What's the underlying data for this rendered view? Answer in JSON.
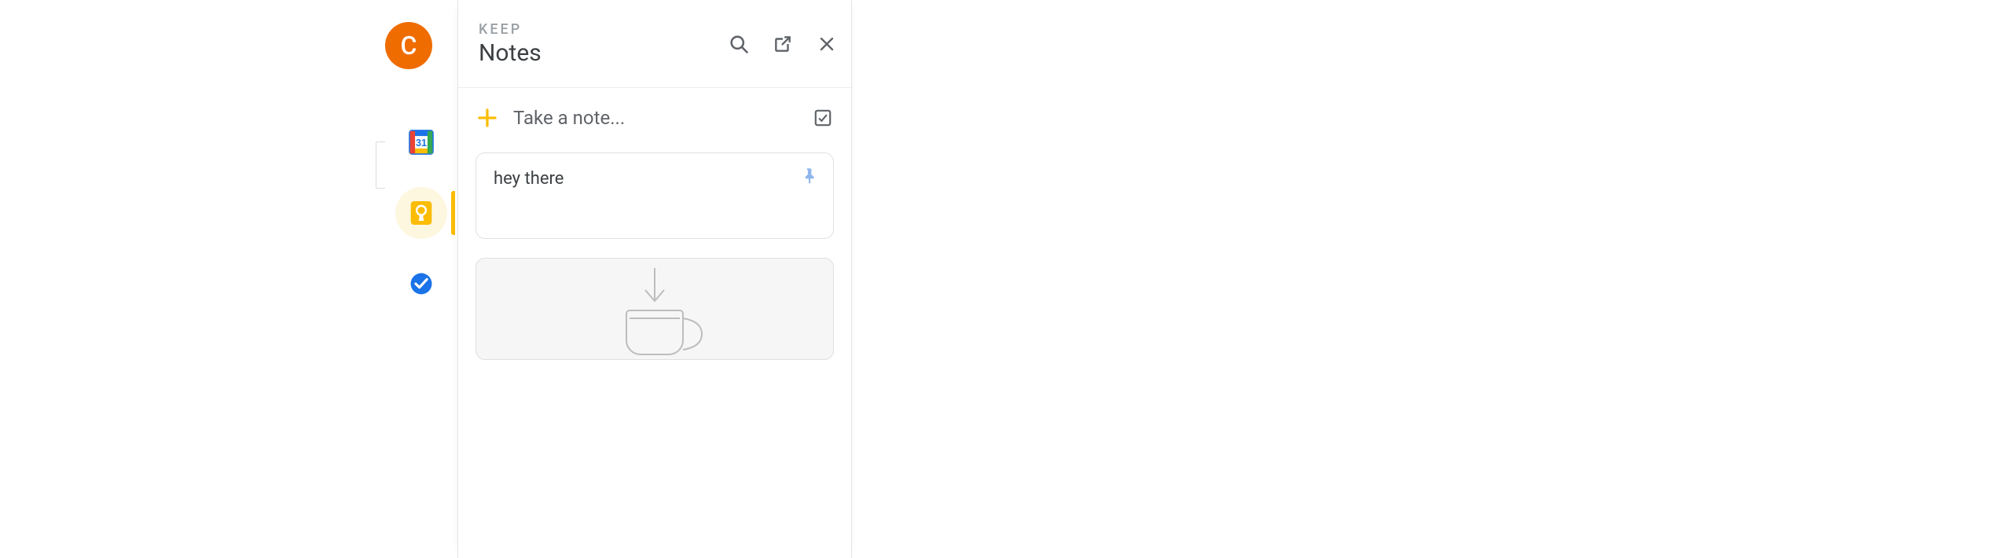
{
  "avatar": {
    "letter": "C",
    "bg": "#ef6c00"
  },
  "rail": {
    "items": [
      {
        "id": "calendar",
        "name": "calendar-icon",
        "active": false
      },
      {
        "id": "keep",
        "name": "keep-icon",
        "active": true
      },
      {
        "id": "tasks",
        "name": "tasks-icon",
        "active": false
      }
    ]
  },
  "panel": {
    "eyebrow": "KEEP",
    "title": "Notes",
    "actions": {
      "search": "Search",
      "open_new": "Open in new tab",
      "close": "Close"
    },
    "compose": {
      "placeholder": "Take a note...",
      "plus_label": "Add note",
      "checklist_label": "New list"
    },
    "notes": [
      {
        "text": "hey there",
        "pinned": true
      }
    ],
    "drawing_note": {
      "present": true
    }
  }
}
